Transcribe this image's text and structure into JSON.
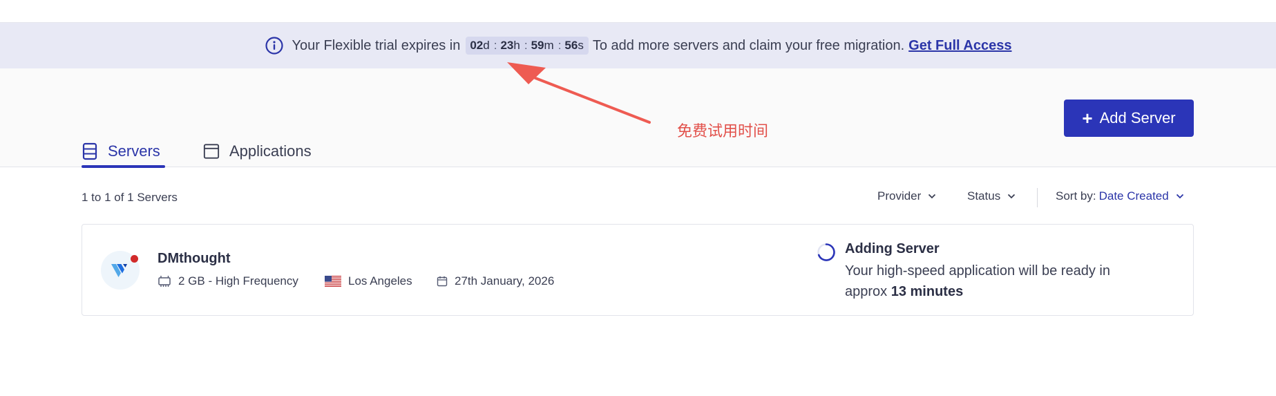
{
  "banner": {
    "prefix": "Your Flexible trial expires in",
    "countdown": {
      "days": "02",
      "days_unit": "d",
      "hours": "23",
      "hours_unit": "h",
      "minutes": "59",
      "minutes_unit": "m",
      "seconds": "56",
      "seconds_unit": "s",
      "separator": ":"
    },
    "message": "To add more servers and claim your free migration.",
    "cta_label": "Get Full Access"
  },
  "annotation": {
    "text": "免费试用时间",
    "color": "#e2504a"
  },
  "header": {
    "add_server_icon": "+",
    "add_server_label": "Add Server",
    "tabs": [
      {
        "label": "Servers",
        "icon": "server-icon",
        "active": true
      },
      {
        "label": "Applications",
        "icon": "window-icon",
        "active": false
      }
    ]
  },
  "list": {
    "count_text": "1 to 1 of 1 Servers",
    "filters": {
      "provider_label": "Provider",
      "status_label": "Status",
      "sort_prefix": "Sort by:",
      "sort_value": "Date Created"
    }
  },
  "server": {
    "name": "DMthought",
    "provider_icon": "vultr-logo",
    "status_dot_color": "#d12a2a",
    "plan": "2 GB - High Frequency",
    "location": "Los Angeles",
    "location_flag": "us-flag-icon",
    "created": "27th January, 2026",
    "status_title": "Adding Server",
    "status_desc_prefix": "Your high-speed application will be ready in approx",
    "status_eta": "13 minutes"
  },
  "colors": {
    "accent": "#2b35b8",
    "banner_bg": "#e8e9f5",
    "link": "#2b35a8"
  }
}
